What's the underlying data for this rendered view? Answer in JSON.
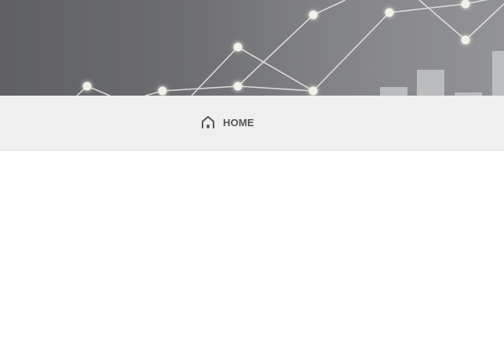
{
  "nav": {
    "home_label": "HOME",
    "home_icon": "home-icon"
  },
  "colors": {
    "nav_background": "#efefef",
    "nav_text": "#555555",
    "banner_dark": "#5f6063",
    "banner_light": "#929396"
  }
}
